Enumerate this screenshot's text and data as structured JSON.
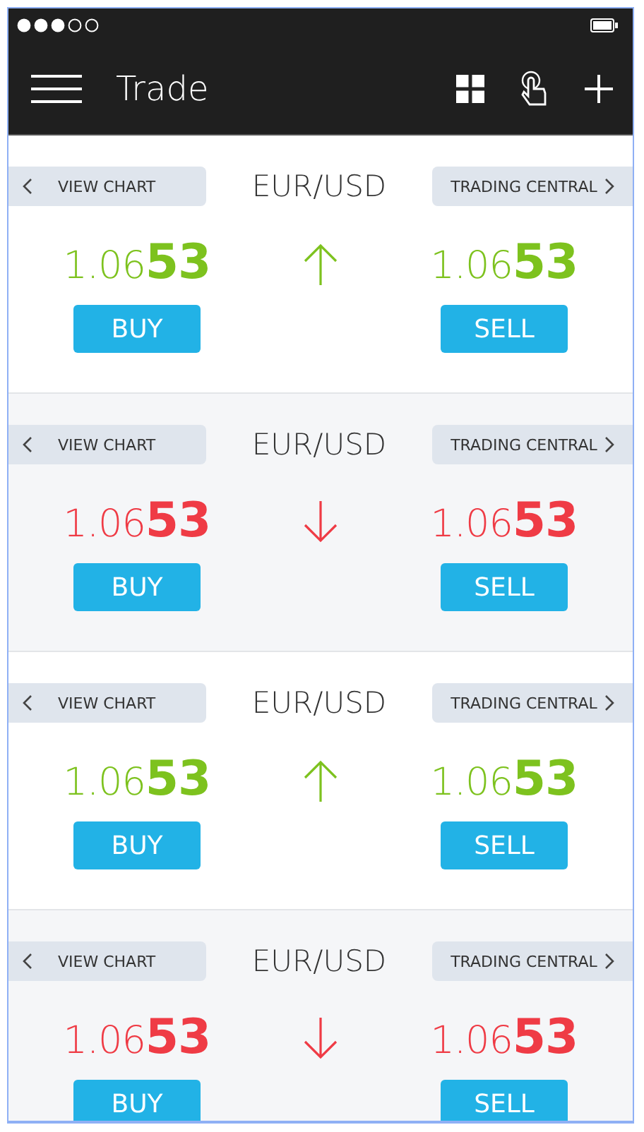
{
  "header": {
    "title": "Trade"
  },
  "quotes": [
    {
      "view_chart": "VIEW CHART",
      "pair": "EUR/USD",
      "trading_central": "TRADING CENTRAL",
      "rising": true,
      "buy_price": "1.06**53**",
      "sell_price": "1.06**53**",
      "buy": "BUY",
      "sell": "SELL"
    },
    {
      "view_chart": "VIEW CHART",
      "pair": "EUR/USD",
      "trading_central": "TRADING CENTRAL",
      "rising": false,
      "buy_price": "1.06**53**",
      "sell_price": "1.06**53**",
      "buy": "BUY",
      "sell": "SELL"
    },
    {
      "view_chart": "VIEW CHART",
      "pair": "EUR/USD",
      "trading_central": "TRADING CENTRAL",
      "rising": true,
      "buy_price": "1.06**53**",
      "sell_price": "1.06**53**",
      "buy": "BUY",
      "sell": "SELL"
    },
    {
      "view_chart": "VIEW CHART",
      "pair": "EUR/USD",
      "trading_central": "TRADING CENTRAL",
      "rising": false,
      "buy_price": "1.06**53**",
      "sell_price": "1.06**53**",
      "buy": "BUY",
      "sell": "SELL"
    }
  ]
}
